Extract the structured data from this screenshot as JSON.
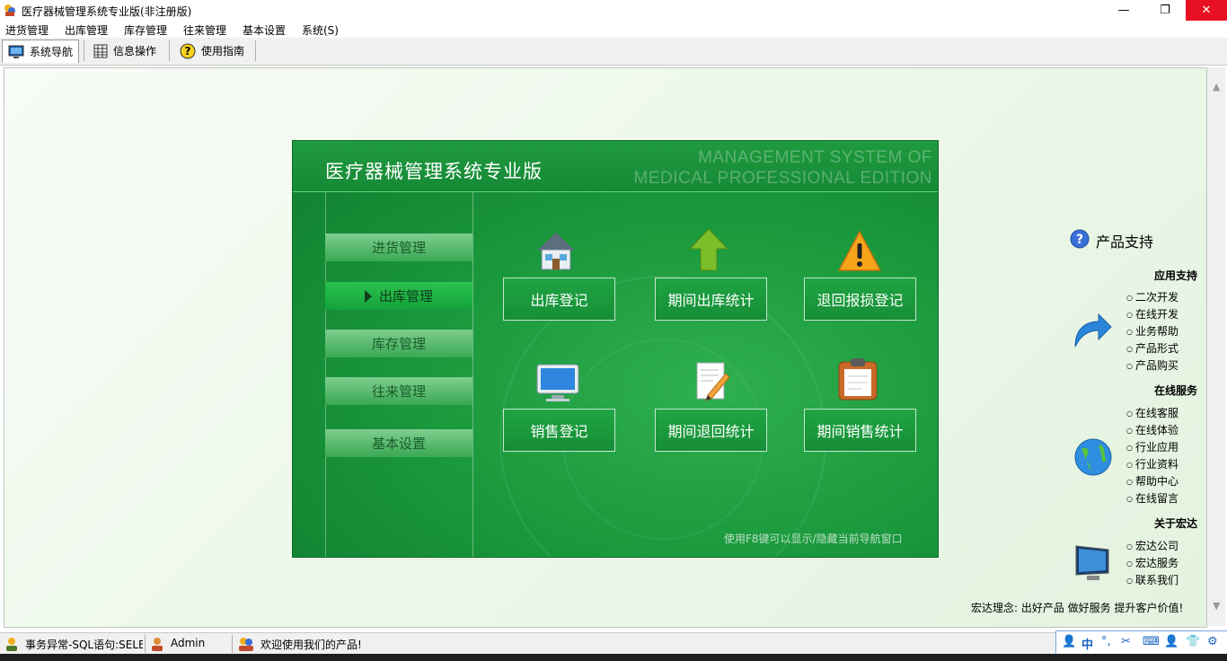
{
  "window": {
    "title": "医疗器械管理系统专业版(非注册版)",
    "controls": {
      "minimize": "—",
      "maximize": "❐",
      "close": "✕"
    }
  },
  "menu": [
    "进货管理",
    "出库管理",
    "库存管理",
    "往来管理",
    "基本设置",
    "系统(S)"
  ],
  "tabs": [
    {
      "label": "系统导航",
      "icon": "monitor-icon",
      "active": true
    },
    {
      "label": "信息操作",
      "icon": "grid-icon",
      "active": false
    },
    {
      "label": "使用指南",
      "icon": "help-icon",
      "active": false
    }
  ],
  "panel": {
    "title": "医疗器械管理系统专业版",
    "watermark_line1": "MANAGEMENT SYSTEM OF",
    "watermark_line2": "MEDICAL PROFESSIONAL EDITION",
    "side_nav": [
      "进货管理",
      "出库管理",
      "库存管理",
      "往来管理",
      "基本设置"
    ],
    "active_side": "出库管理",
    "buttons": [
      {
        "label": "出库登记",
        "icon": "house-icon"
      },
      {
        "label": "期间出库统计",
        "icon": "up-arrow-icon"
      },
      {
        "label": "退回报损登记",
        "icon": "warning-icon"
      },
      {
        "label": "销售登记",
        "icon": "monitor-icon"
      },
      {
        "label": "期间退回统计",
        "icon": "edit-document-icon"
      },
      {
        "label": "期间销售统计",
        "icon": "clipboard-icon"
      }
    ],
    "hint": "使用F8键可以显示/隐藏当前导航窗口"
  },
  "support": {
    "title": "产品支持",
    "sections": [
      {
        "title": "应用支持",
        "icon": "arrow-icon",
        "links": [
          "二次开发",
          "在线开发",
          "业务帮助",
          "产品形式",
          "产品购买"
        ]
      },
      {
        "title": "在线服务",
        "icon": "globe-icon",
        "links": [
          "在线客服",
          "在线体验",
          "行业应用",
          "行业资料",
          "帮助中心",
          "在线留言"
        ]
      },
      {
        "title": "关于宏达",
        "icon": "computer-icon",
        "links": [
          "宏达公司",
          "宏达服务",
          "联系我们"
        ]
      }
    ],
    "motto": "宏达理念: 出好产品  做好服务  提升客户价值!"
  },
  "status": {
    "error": "事务异常-SQL语句:SELEC",
    "user": "Admin",
    "welcome": "欢迎使用我们的产品!"
  },
  "ime": {
    "lang": "中",
    "punct": "°,",
    "tool": "✂",
    "keyboard": "⌨",
    "person": "👤",
    "shirt": "👕",
    "gear": "⚙"
  },
  "colors": {
    "panel_green": "#1b9a3e",
    "close_red": "#e81123",
    "ime_blue": "#1763c2"
  }
}
